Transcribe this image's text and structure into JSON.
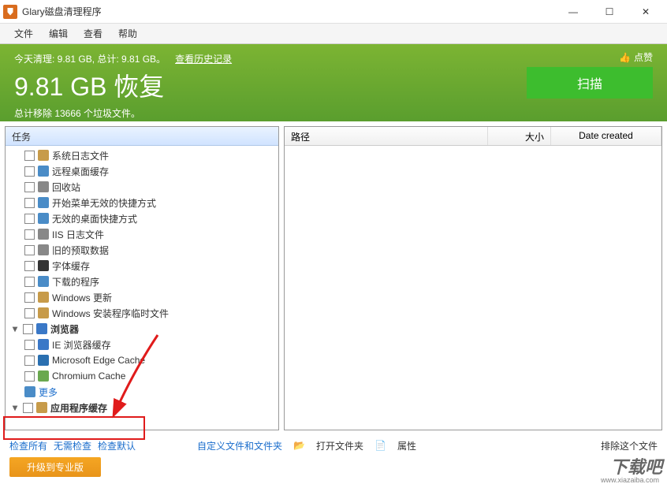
{
  "window": {
    "title": "Glary磁盘清理程序",
    "min": "—",
    "max": "☐",
    "close": "✕"
  },
  "menu": {
    "file": "文件",
    "edit": "编辑",
    "view": "查看",
    "help": "帮助"
  },
  "banner": {
    "today_line": "今天清理: 9.81 GB, 总计: 9.81 GB。",
    "history": "查看历史记录",
    "main": "9.81 GB 恢复",
    "sub": "总计移除 13666 个垃圾文件。",
    "scan": "扫描",
    "like": "点赞"
  },
  "left": {
    "header": "任务",
    "items": [
      {
        "label": "系统日志文件",
        "icon_color": "#c79b4a",
        "group": false
      },
      {
        "label": "远程桌面缓存",
        "icon_color": "#4a8cc7",
        "group": false
      },
      {
        "label": "回收站",
        "icon_color": "#888",
        "group": false
      },
      {
        "label": "开始菜单无效的快捷方式",
        "icon_color": "#4a8cc7",
        "group": false
      },
      {
        "label": "无效的桌面快捷方式",
        "icon_color": "#4a8cc7",
        "group": false
      },
      {
        "label": "IIS 日志文件",
        "icon_color": "#888",
        "group": false
      },
      {
        "label": "旧的预取数据",
        "icon_color": "#888",
        "group": false
      },
      {
        "label": "字体缓存",
        "icon_color": "#333",
        "group": false
      },
      {
        "label": "下载的程序",
        "icon_color": "#4a8cc7",
        "group": false
      },
      {
        "label": "Windows 更新",
        "icon_color": "#c79b4a",
        "group": false
      },
      {
        "label": "Windows 安装程序临时文件",
        "icon_color": "#c79b4a",
        "group": false
      }
    ],
    "browser_group": "浏览器",
    "browsers": [
      {
        "label": "IE 浏览器缓存",
        "icon_color": "#3a78c7"
      },
      {
        "label": "Microsoft Edge Cache",
        "icon_color": "#2a6fb0"
      },
      {
        "label": "Chromium Cache",
        "icon_color": "#6aa84f"
      }
    ],
    "more": "更多",
    "app_cache_group": "应用程序缓存"
  },
  "right": {
    "col_path": "路径",
    "col_size": "大小",
    "col_date": "Date created"
  },
  "links": {
    "check_all": "检查所有",
    "check_none": "无需检查",
    "check_default": "检查默认",
    "custom_files": "自定义文件和文件夹",
    "open_folder": "打开文件夹",
    "properties": "属性",
    "exclude": "排除这个文件"
  },
  "footer": {
    "upgrade": "升级到专业版"
  },
  "watermark": {
    "main": "下载吧",
    "sub": "www.xiazaiba.com"
  }
}
